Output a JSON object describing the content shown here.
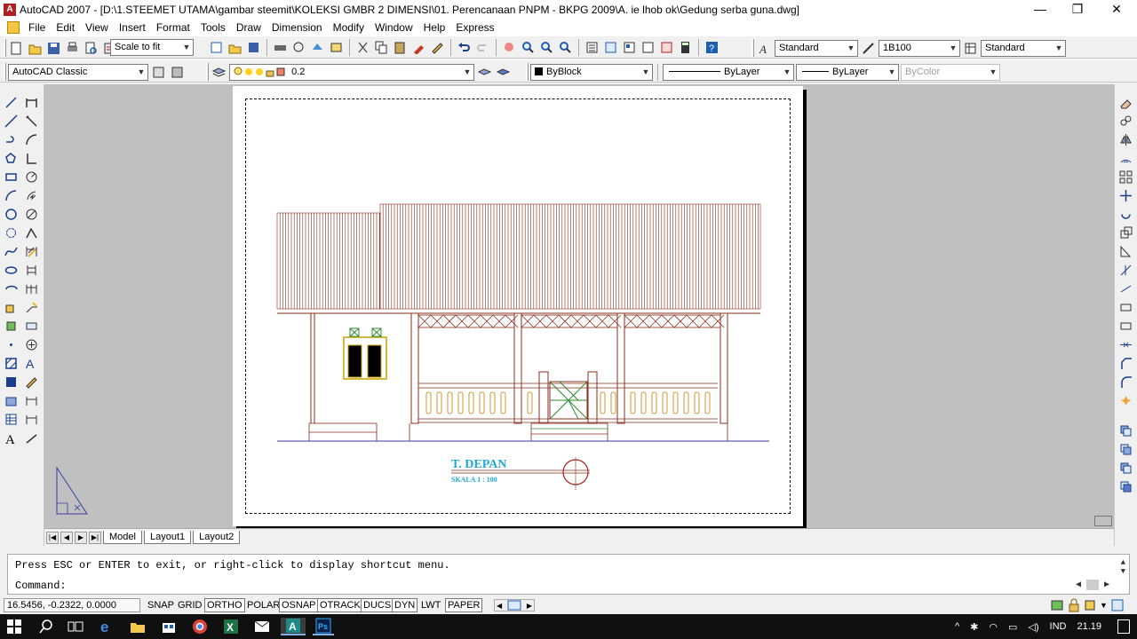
{
  "window": {
    "title": "AutoCAD 2007 - [D:\\1.STEEMET UTAMA\\gambar steemit\\KOLEKSI GMBR 2 DIMENSI\\01. Perencanaan PNPM - BKPG 2009\\A. ie lhob ok\\Gedung serba guna.dwg]",
    "controls": {
      "minimize": "—",
      "restore": "❐",
      "close": "✕"
    }
  },
  "menu": {
    "items": [
      "File",
      "Edit",
      "View",
      "Insert",
      "Format",
      "Tools",
      "Draw",
      "Dimension",
      "Modify",
      "Window",
      "Help",
      "Express"
    ]
  },
  "toolbars": {
    "zoom_combo": "Scale to fit",
    "text_style": "Standard",
    "dim_style": "1B100",
    "table_style": "Standard",
    "workspace": "AutoCAD Classic",
    "layer": "0.2",
    "color": "ByBlock",
    "linetype": "ByLayer",
    "lineweight": "ByLayer",
    "plotstyle": "ByColor"
  },
  "drawing": {
    "title": "T. DEPAN",
    "scale": "SKALA  1 : 100"
  },
  "tabs": [
    "Model",
    "Layout1",
    "Layout2"
  ],
  "command": {
    "line1": "Press ESC or ENTER to exit, or right-click to display shortcut menu.",
    "prompt": "Command:"
  },
  "status": {
    "coords": "16.5456, -0.2322, 0.0000",
    "buttons": [
      {
        "label": "SNAP",
        "on": false
      },
      {
        "label": "GRID",
        "on": false
      },
      {
        "label": "ORTHO",
        "on": true
      },
      {
        "label": "POLAR",
        "on": false
      },
      {
        "label": "OSNAP",
        "on": true
      },
      {
        "label": "OTRACK",
        "on": true
      },
      {
        "label": "DUCS",
        "on": true
      },
      {
        "label": "DYN",
        "on": true
      },
      {
        "label": "LWT",
        "on": false
      },
      {
        "label": "PAPER",
        "on": true
      }
    ]
  },
  "taskbar": {
    "language": "IND",
    "time": "21.19"
  },
  "colors": {
    "roof": "#8b2e1e",
    "walls": "#8b2e1e",
    "ornament": "#2e8b2e",
    "title_text": "#1fa8d8",
    "ground": "#3a3aa0"
  }
}
